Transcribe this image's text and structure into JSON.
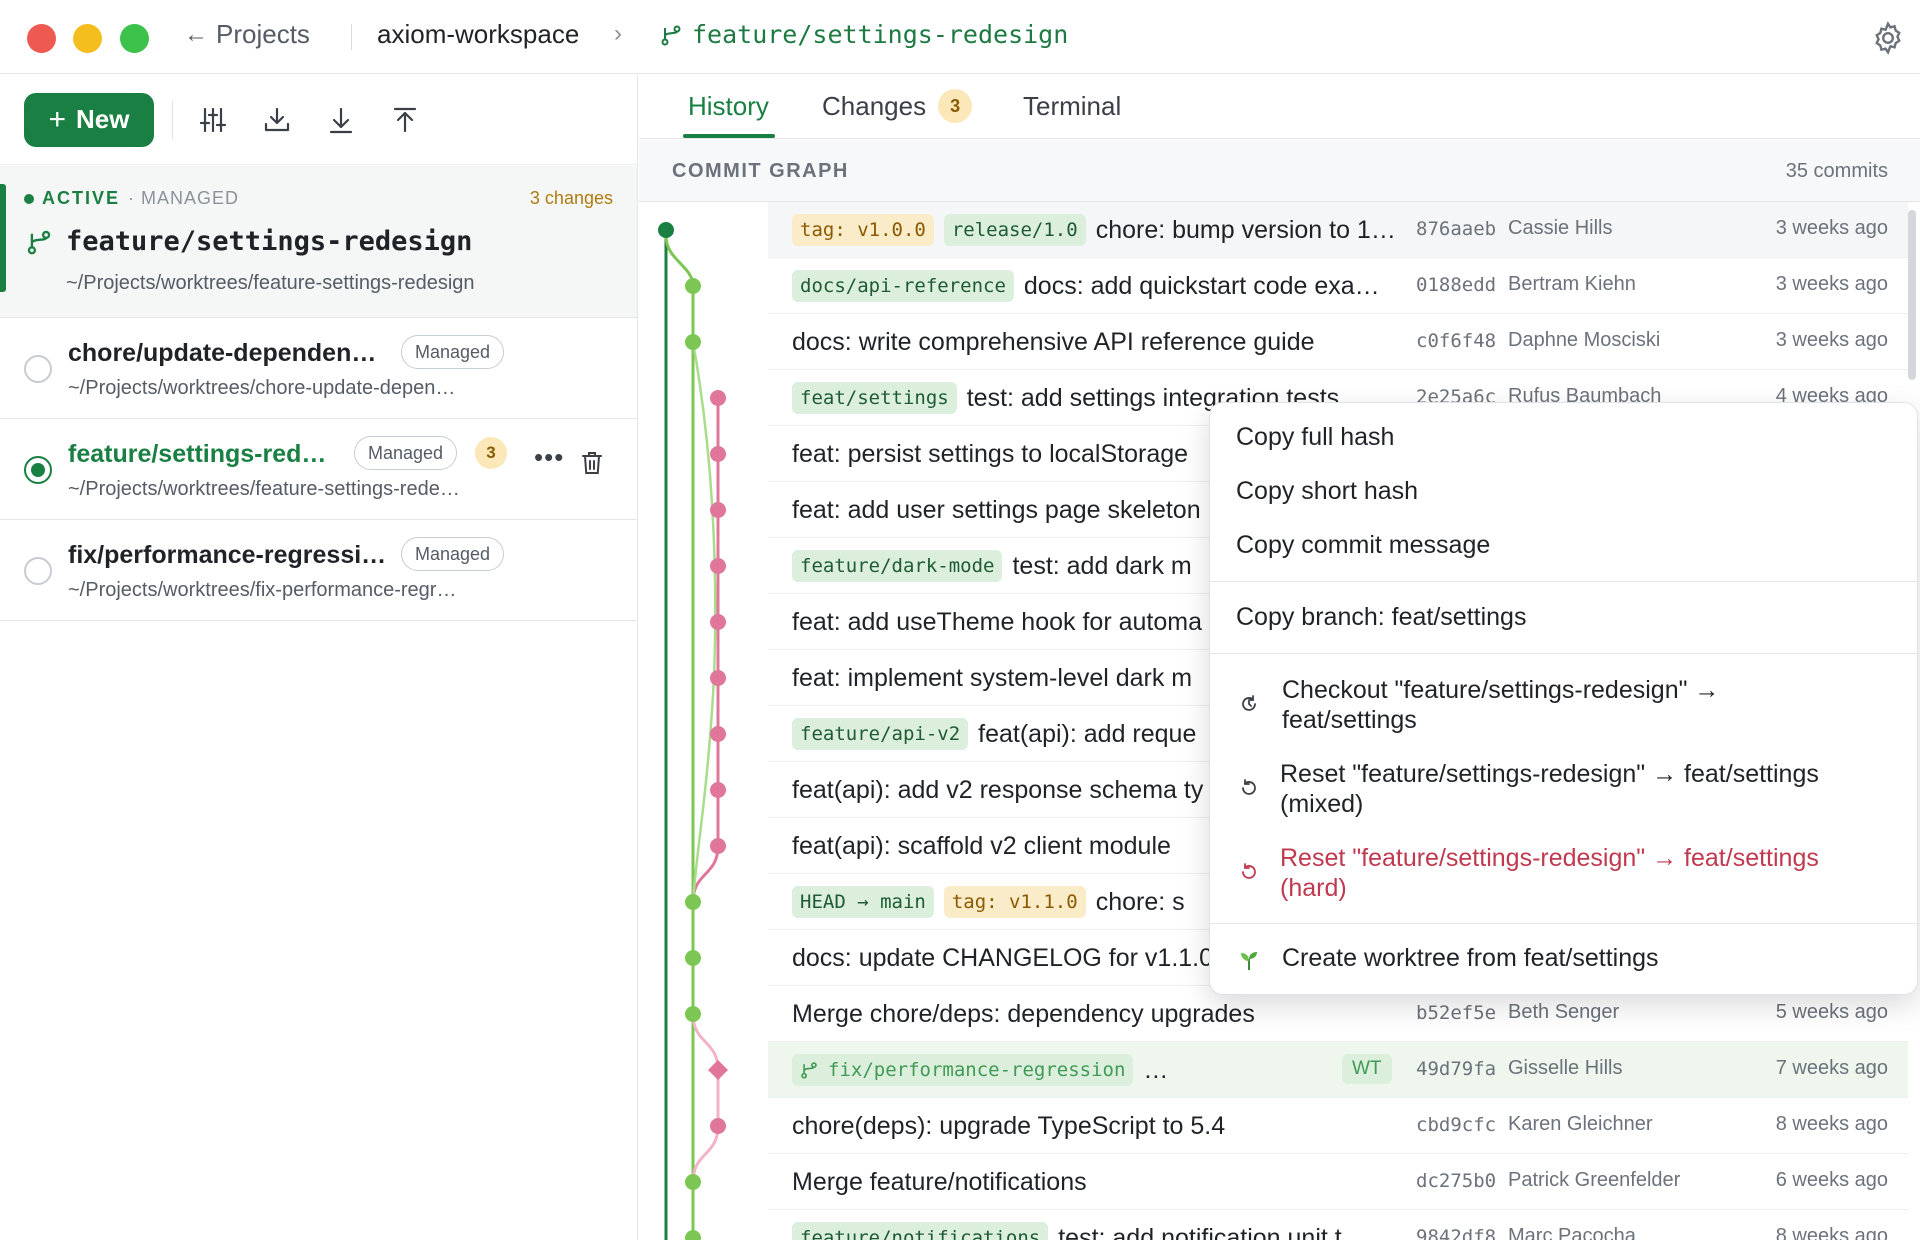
{
  "titlebar": {
    "back_label": "Projects",
    "workspace": "axiom-workspace",
    "current_branch": "feature/settings-redesign"
  },
  "sidebar": {
    "new_button": "New",
    "active": {
      "status": "ACTIVE",
      "kind": "· MANAGED",
      "changes": "3 changes",
      "branch": "feature/settings-redesign",
      "path": "~/Projects/worktrees/feature-settings-redesign"
    },
    "worktrees": [
      {
        "name": "chore/update-dependen…",
        "badge": "Managed",
        "path": "~/Projects/worktrees/chore-update-depen…",
        "selected": false
      },
      {
        "name": "feature/settings-red…",
        "badge": "Managed",
        "count": "3",
        "path": "~/Projects/worktrees/feature-settings-rede…",
        "selected": true
      },
      {
        "name": "fix/performance-regressi…",
        "badge": "Managed",
        "path": "~/Projects/worktrees/fix-performance-regr…",
        "selected": false
      }
    ]
  },
  "tabs": {
    "history": "History",
    "changes": "Changes",
    "changes_count": "3",
    "terminal": "Terminal"
  },
  "graph": {
    "title": "COMMIT GRAPH",
    "count": "35 commits",
    "commits": [
      {
        "chips": [
          {
            "type": "tag",
            "label": "tag: v1.0.0"
          },
          {
            "type": "branch",
            "label": "release/1.0"
          }
        ],
        "message": "chore: bump version to 1…",
        "hash": "876aaeb",
        "author": "Cassie Hills",
        "when": "3 weeks ago"
      },
      {
        "chips": [
          {
            "type": "branch",
            "label": "docs/api-reference"
          }
        ],
        "message": "docs: add quickstart code exa…",
        "hash": "0188edd",
        "author": "Bertram Kiehn",
        "when": "3 weeks ago"
      },
      {
        "chips": [],
        "message": "docs: write comprehensive API reference guide",
        "hash": "c0f6f48",
        "author": "Daphne Mosciski",
        "when": "3 weeks ago"
      },
      {
        "chips": [
          {
            "type": "branch",
            "label": "feat/settings"
          }
        ],
        "message": "test: add settings integration tests",
        "hash": "2e25a6c",
        "author": "Rufus Baumbach",
        "when": "4 weeks ago"
      },
      {
        "chips": [],
        "message": "feat: persist settings to localStorage",
        "hash": "",
        "author": "",
        "when": ""
      },
      {
        "chips": [],
        "message": "feat: add user settings page skeleton",
        "hash": "",
        "author": "",
        "when": ""
      },
      {
        "chips": [
          {
            "type": "branch",
            "label": "feature/dark-mode"
          }
        ],
        "message": "test: add dark m",
        "hash": "",
        "author": "",
        "when": ""
      },
      {
        "chips": [],
        "message": "feat: add useTheme hook for automa",
        "hash": "",
        "author": "",
        "when": ""
      },
      {
        "chips": [],
        "message": "feat: implement system-level dark m",
        "hash": "",
        "author": "",
        "when": ""
      },
      {
        "chips": [
          {
            "type": "branch",
            "label": "feature/api-v2"
          }
        ],
        "message": "feat(api): add reque",
        "hash": "",
        "author": "",
        "when": ""
      },
      {
        "chips": [],
        "message": "feat(api): add v2 response schema ty",
        "hash": "",
        "author": "",
        "when": ""
      },
      {
        "chips": [],
        "message": "feat(api): scaffold v2 client module",
        "hash": "",
        "author": "",
        "when": ""
      },
      {
        "chips": [
          {
            "type": "head",
            "label": "HEAD → main"
          },
          {
            "type": "tag",
            "label": "tag: v1.1.0"
          }
        ],
        "message": "chore: s",
        "hash": "",
        "author": "",
        "when": ""
      },
      {
        "chips": [],
        "message": "docs: update CHANGELOG for v1.1.0",
        "hash": "",
        "author": "",
        "when": ""
      },
      {
        "chips": [],
        "message": "Merge chore/deps: dependency upgrades",
        "hash": "b52ef5e",
        "author": "Beth Senger",
        "when": "5 weeks ago"
      },
      {
        "chips": [
          {
            "type": "wtbranch",
            "label": "fix/performance-regression"
          }
        ],
        "message": "…",
        "wt": "WT",
        "hash": "49d79fa",
        "author": "Gisselle Hills",
        "when": "7 weeks ago"
      },
      {
        "chips": [],
        "message": "chore(deps): upgrade TypeScript to 5.4",
        "hash": "cbd9cfc",
        "author": "Karen Gleichner",
        "when": "8 weeks ago"
      },
      {
        "chips": [],
        "message": "Merge feature/notifications",
        "hash": "dc275b0",
        "author": "Patrick Greenfelder",
        "when": "6 weeks ago"
      },
      {
        "chips": [
          {
            "type": "branch",
            "label": "feature/notifications"
          }
        ],
        "message": "test: add notification unit t…",
        "hash": "9842df8",
        "author": "Marc Pacocha",
        "when": "8 weeks ago"
      }
    ]
  },
  "context_menu": {
    "copy_full": "Copy full hash",
    "copy_short": "Copy short hash",
    "copy_message": "Copy commit message",
    "copy_branch": "Copy branch: feat/settings",
    "checkout": "Checkout \"feature/settings-redesign\" → feat/settings",
    "reset_mixed": "Reset \"feature/settings-redesign\" → feat/settings (mixed)",
    "reset_hard": "Reset \"feature/settings-redesign\" → feat/settings (hard)",
    "create_worktree": "Create worktree from feat/settings"
  },
  "colors": {
    "accent": "#1a7f42",
    "lane_main": "#7cc653",
    "lane_feat": "#e0779b",
    "danger": "#c0394f"
  }
}
